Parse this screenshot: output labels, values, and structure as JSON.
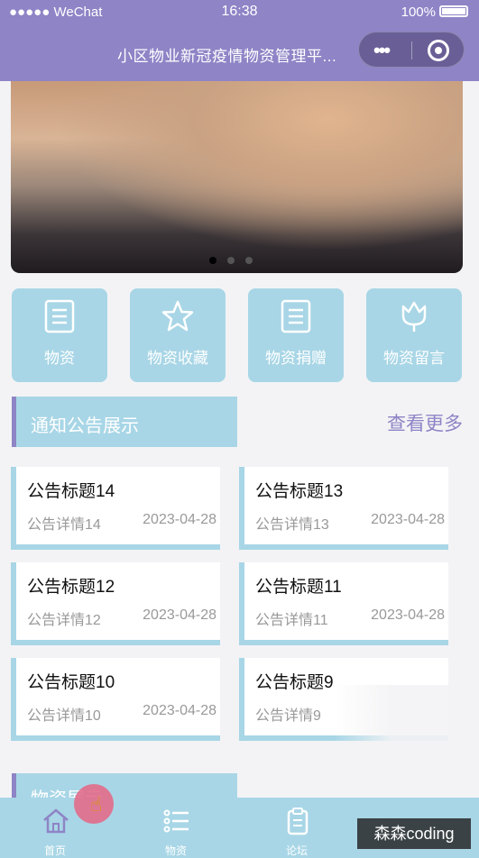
{
  "status_bar": {
    "carrier": "●●●●● WeChat",
    "time": "16:38",
    "battery": "100%"
  },
  "nav": {
    "title": "小区物业新冠疫情物资管理平..."
  },
  "categories": [
    {
      "label": "物资",
      "icon": "document-icon"
    },
    {
      "label": "物资收藏",
      "icon": "star-icon"
    },
    {
      "label": "物资捐赠",
      "icon": "document-icon"
    },
    {
      "label": "物资留言",
      "icon": "tulip-icon"
    }
  ],
  "notice_section": {
    "title": "通知公告展示",
    "more": "查看更多"
  },
  "notices": [
    {
      "title": "公告标题14",
      "detail": "公告详情14",
      "date": "2023-04-28"
    },
    {
      "title": "公告标题13",
      "detail": "公告详情13",
      "date": "2023-04-28"
    },
    {
      "title": "公告标题12",
      "detail": "公告详情12",
      "date": "2023-04-28"
    },
    {
      "title": "公告标题11",
      "detail": "公告详情11",
      "date": "2023-04-28"
    },
    {
      "title": "公告标题10",
      "detail": "公告详情10",
      "date": "2023-04-28"
    },
    {
      "title": "公告标题9",
      "detail": "公告详情9",
      "date": ""
    }
  ],
  "next_section": {
    "title": "物资展示"
  },
  "tabs": [
    {
      "label": "首页",
      "icon": "home-icon"
    },
    {
      "label": "物资",
      "icon": "list-icon"
    },
    {
      "label": "论坛",
      "icon": "clipboard-icon"
    }
  ],
  "watermark": "森森coding",
  "colors": {
    "accent": "#8e84c6",
    "tile": "#a8d6e6"
  }
}
